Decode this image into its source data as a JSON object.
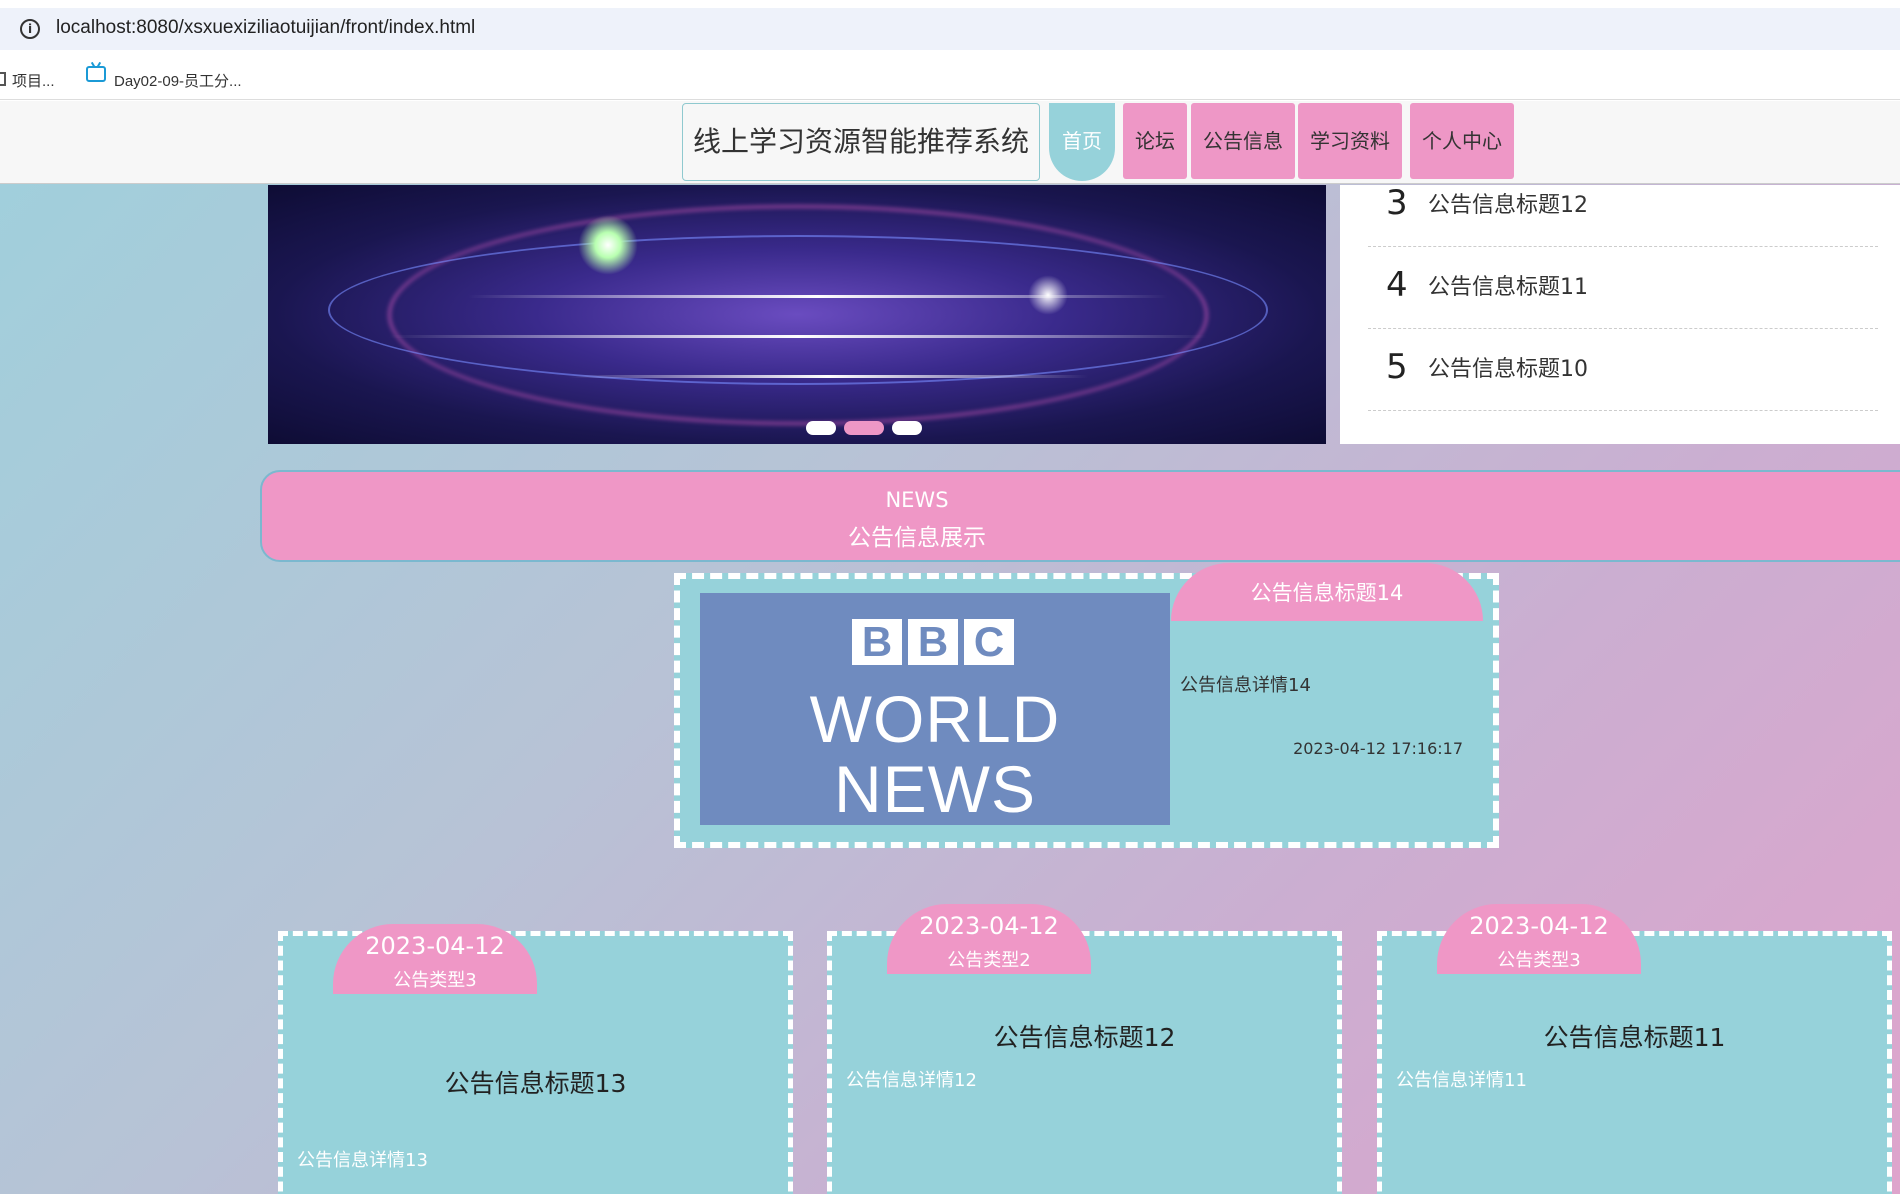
{
  "browser": {
    "url": "localhost:8080/xsxuexiziliaotuijian/front/index.html",
    "bookmarks": [
      "项目...",
      "Day02-09-员工分..."
    ]
  },
  "nav": {
    "site_title": "线上学习资源智能推荐系统",
    "items": [
      "首页",
      "论坛",
      "公告信息",
      "学习资料",
      "个人中心"
    ],
    "active": "首页"
  },
  "notice_list": [
    {
      "num": "3",
      "title": "公告信息标题12"
    },
    {
      "num": "4",
      "title": "公告信息标题11"
    },
    {
      "num": "5",
      "title": "公告信息标题10"
    }
  ],
  "news_section": {
    "en": "NEWS",
    "cn": "公告信息展示"
  },
  "feature": {
    "image_letters": [
      "B",
      "B",
      "C"
    ],
    "image_line1": "WORLD",
    "image_line2": "NEWS",
    "title": "公告信息标题14",
    "detail": "公告信息详情14",
    "time": "2023-04-12 17:16:17"
  },
  "cards": [
    {
      "date": "2023-04-12",
      "type": "公告类型3",
      "title": "公告信息标题13",
      "detail": "公告信息详情13"
    },
    {
      "date": "2023-04-12",
      "type": "公告类型2",
      "title": "公告信息标题12",
      "detail": "公告信息详情12"
    },
    {
      "date": "2023-04-12",
      "type": "公告类型3",
      "title": "公告信息标题11",
      "detail": "公告信息详情11"
    }
  ],
  "colors": {
    "pink": "#ef97c6",
    "teal": "#96d2da"
  }
}
